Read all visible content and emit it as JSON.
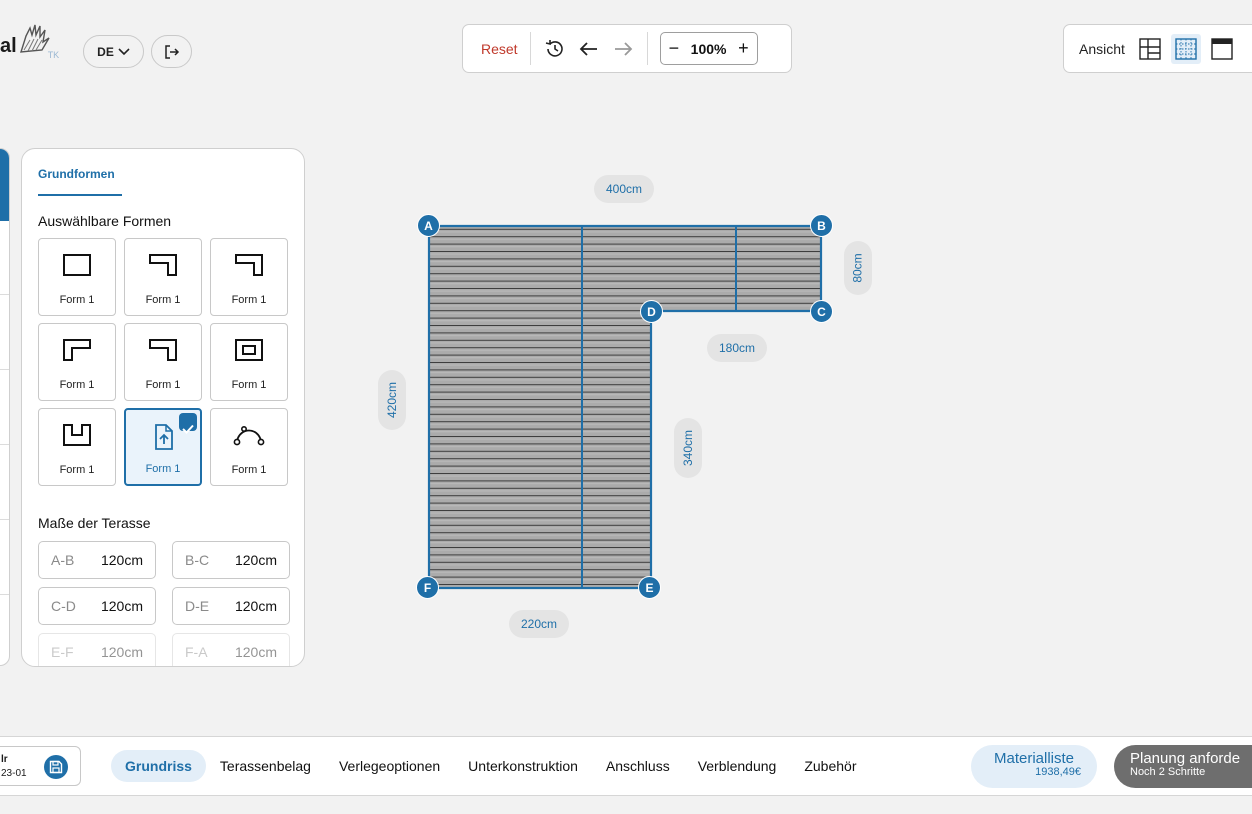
{
  "header": {
    "logo_text": "al",
    "logo_sub": "TK",
    "language": "DE",
    "toolbar": {
      "reset_label": "Reset",
      "zoom": "100%"
    },
    "view_label": "Ansicht"
  },
  "panel": {
    "tab": "Grundformen",
    "shapes_title": "Auswählbare Formen",
    "shapes": [
      {
        "label": "Form 1",
        "icon": "rectangle-shape-icon"
      },
      {
        "label": "Form 1",
        "icon": "notch-right-shape-icon"
      },
      {
        "label": "Form 1",
        "icon": "notch-right-shape-icon"
      },
      {
        "label": "Form 1",
        "icon": "notch-left-shape-icon"
      },
      {
        "label": "Form 1",
        "icon": "notch-right-shape-icon"
      },
      {
        "label": "Form 1",
        "icon": "frame-shape-icon"
      },
      {
        "label": "Form 1",
        "icon": "u-shape-icon"
      },
      {
        "label": "Form 1",
        "icon": "upload-file-icon",
        "selected": true
      },
      {
        "label": "Form 1",
        "icon": "bezier-curve-icon"
      }
    ],
    "dims_title": "Maße der Terasse",
    "dims": [
      {
        "key": "A-B",
        "value": "120cm"
      },
      {
        "key": "B-C",
        "value": "120cm"
      },
      {
        "key": "C-D",
        "value": "120cm"
      },
      {
        "key": "D-E",
        "value": "120cm"
      },
      {
        "key": "E-F",
        "value": "120cm"
      },
      {
        "key": "F-A",
        "value": "120cm"
      }
    ]
  },
  "canvas": {
    "dimensions": {
      "top": "400cm",
      "right_short": "80cm",
      "inner_horizontal": "180cm",
      "left": "420cm",
      "inner_vertical": "340cm",
      "bottom": "220cm"
    },
    "corners": [
      "A",
      "B",
      "C",
      "D",
      "E",
      "F"
    ],
    "colors": {
      "accent": "#1f6fa8",
      "deck": "#a9a9a9"
    }
  },
  "bottom": {
    "project_name": "lr",
    "project_id": "23-01",
    "nav": [
      "Grundriss",
      "Terassenbelag",
      "Verlegeoptionen",
      "Unterkonstruktion",
      "Anschluss",
      "Verblendung",
      "Zubehör"
    ],
    "active_nav": "Grundriss",
    "material_label": "Materialliste",
    "material_price": "1938,49€",
    "plan_label": "Planung anforde",
    "plan_sub": "Noch 2 Schritte"
  }
}
